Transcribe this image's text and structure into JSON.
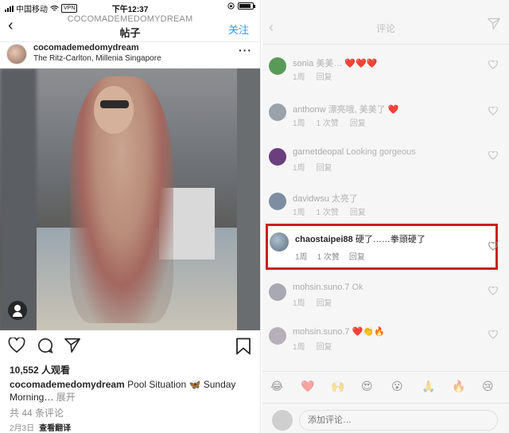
{
  "status_bar": {
    "carrier": "中国移动",
    "vpn": "VPN",
    "time": "下午12:37"
  },
  "left": {
    "nav": {
      "subtitle": "COCOMADEMEDOMYDREAM",
      "title": "帖子",
      "follow": "关注"
    },
    "post": {
      "username": "cocomademedomydream",
      "location": "The Ritz-Carlton, Millenia Singapore",
      "views": "10,552 人观看",
      "caption_user": "cocomademedomydream",
      "caption_text": " Pool Situation 🦋 Sunday Morning… ",
      "caption_expand": "展开",
      "comments_count": "共 44 条评论",
      "date": "2月3日",
      "translate": "查看翻译"
    }
  },
  "right": {
    "title": "评论",
    "comments": [
      {
        "user": "sonia",
        "text": "美美… ❤️❤️❤️",
        "time": "1周",
        "likes": "",
        "reply": "回复"
      },
      {
        "user": "anthonw",
        "text": "漂亮哦, 美美了 ❤️",
        "time": "1周",
        "likes": "1 次赞",
        "reply": "回复"
      },
      {
        "user": "garnetdeopal",
        "text": "Looking gorgeous",
        "time": "1周",
        "likes": "",
        "reply": "回复"
      },
      {
        "user": "davidwsu",
        "text": "太亮了",
        "time": "1周",
        "likes": "1 次赞",
        "reply": "回复"
      },
      {
        "user": "mohsin.suno.7",
        "text": "Ok",
        "time": "1周",
        "likes": "",
        "reply": "回复"
      },
      {
        "user": "mohsin.suno.7",
        "text": "❤️👏🔥",
        "time": "1周",
        "likes": "",
        "reply": "回复"
      }
    ],
    "highlighted": {
      "user": "chaostaipei88",
      "text": " 硬了……拳頭硬了",
      "time": "1周",
      "likes": "1 次贊",
      "reply": "回复"
    },
    "emojis": [
      "😂",
      "❤️",
      "🙌",
      "😍",
      "😮",
      "🙏",
      "🔥",
      "😢"
    ],
    "composer_placeholder": "添加评论…"
  }
}
